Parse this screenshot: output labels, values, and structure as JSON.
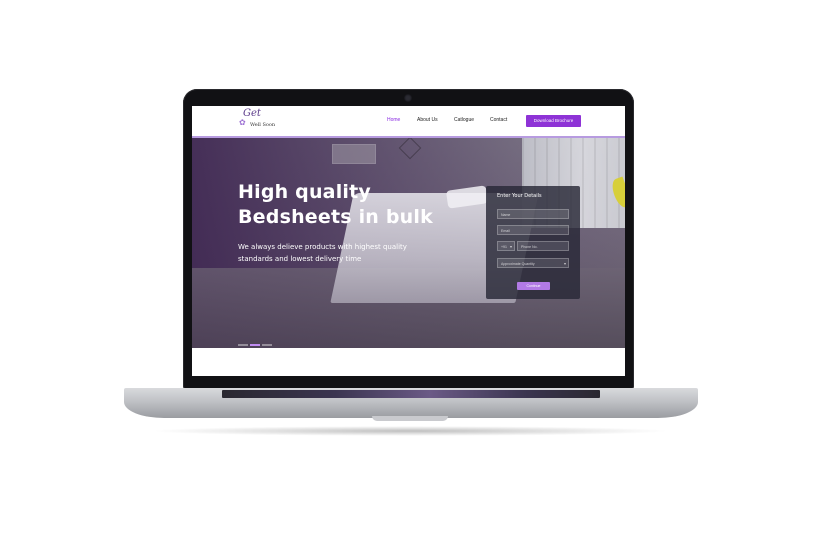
{
  "nav": {
    "logo_script": "Get",
    "logo_name": "Well Soon",
    "items": [
      "Home",
      "About Us",
      "Catlogue",
      "Contact"
    ],
    "cta": "Download Brochure"
  },
  "hero": {
    "title_line1": "High quality",
    "title_line2": "Bedsheets in bulk",
    "subtitle": "We always delieve products with highest quality standards and lowest delivery time",
    "slide_count": 3,
    "active_slide": 1
  },
  "form": {
    "title": "Enter Your Details",
    "name_placeholder": "Name",
    "email_placeholder": "Email",
    "country_code": "+91",
    "phone_placeholder": "Phone No.",
    "quantity_placeholder": "Approximate Quantity",
    "continue_label": "Continue"
  },
  "colors": {
    "accent": "#8e33d6",
    "button_light": "#b27ae6",
    "nav_border": "#b79be0"
  }
}
